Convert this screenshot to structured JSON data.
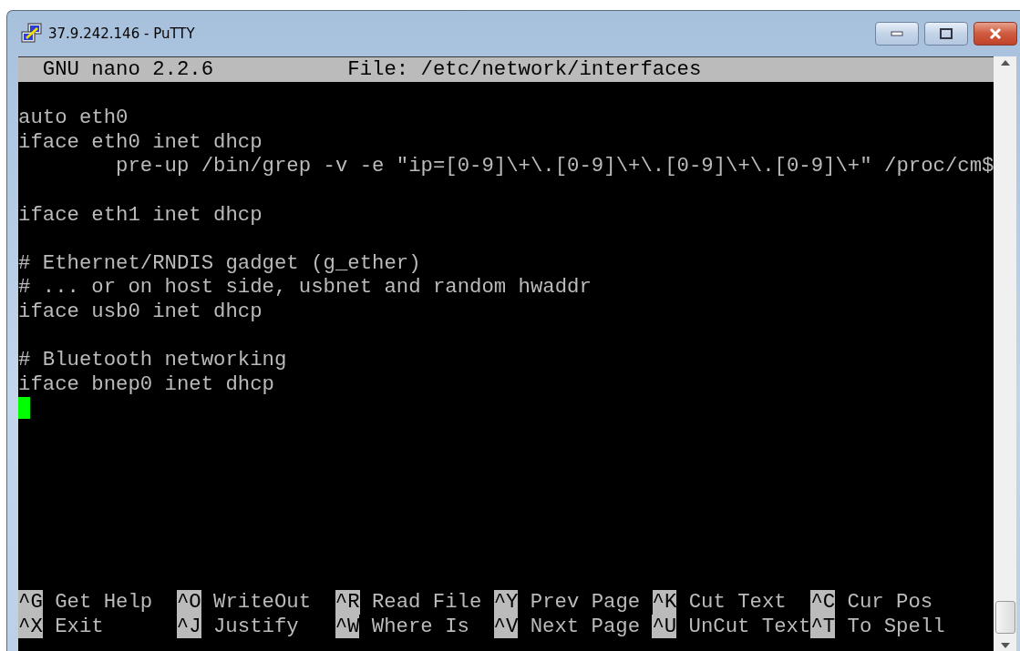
{
  "window": {
    "title": "37.9.242.146 - PuTTY"
  },
  "header": {
    "program": "GNU nano 2.2.6",
    "file": "File: /etc/network/interfaces"
  },
  "blocks": [
    [
      "auto eth0",
      "iface eth0 inet dhcp",
      "        pre-up /bin/grep -v -e \"ip=[0-9]\\+\\.[0-9]\\+\\.[0-9]\\+\\.[0-9]\\+\" /proc/cm$"
    ],
    [
      "iface eth1 inet dhcp"
    ],
    [
      "# Ethernet/RNDIS gadget (g_ether)",
      "# ... or on host side, usbnet and random hwaddr",
      "iface usb0 inet dhcp"
    ],
    [
      "# Bluetooth networking",
      "iface bnep0 inet dhcp"
    ]
  ],
  "shortcuts": [
    [
      {
        "key": "^G",
        "label": "Get Help"
      },
      {
        "key": "^O",
        "label": "WriteOut"
      },
      {
        "key": "^R",
        "label": "Read File"
      },
      {
        "key": "^Y",
        "label": "Prev Page"
      },
      {
        "key": "^K",
        "label": "Cut Text"
      },
      {
        "key": "^C",
        "label": "Cur Pos"
      }
    ],
    [
      {
        "key": "^X",
        "label": "Exit"
      },
      {
        "key": "^J",
        "label": "Justify"
      },
      {
        "key": "^W",
        "label": "Where Is"
      },
      {
        "key": "^V",
        "label": "Next Page"
      },
      {
        "key": "^U",
        "label": "UnCut Text"
      },
      {
        "key": "^T",
        "label": "To Spell"
      }
    ]
  ]
}
